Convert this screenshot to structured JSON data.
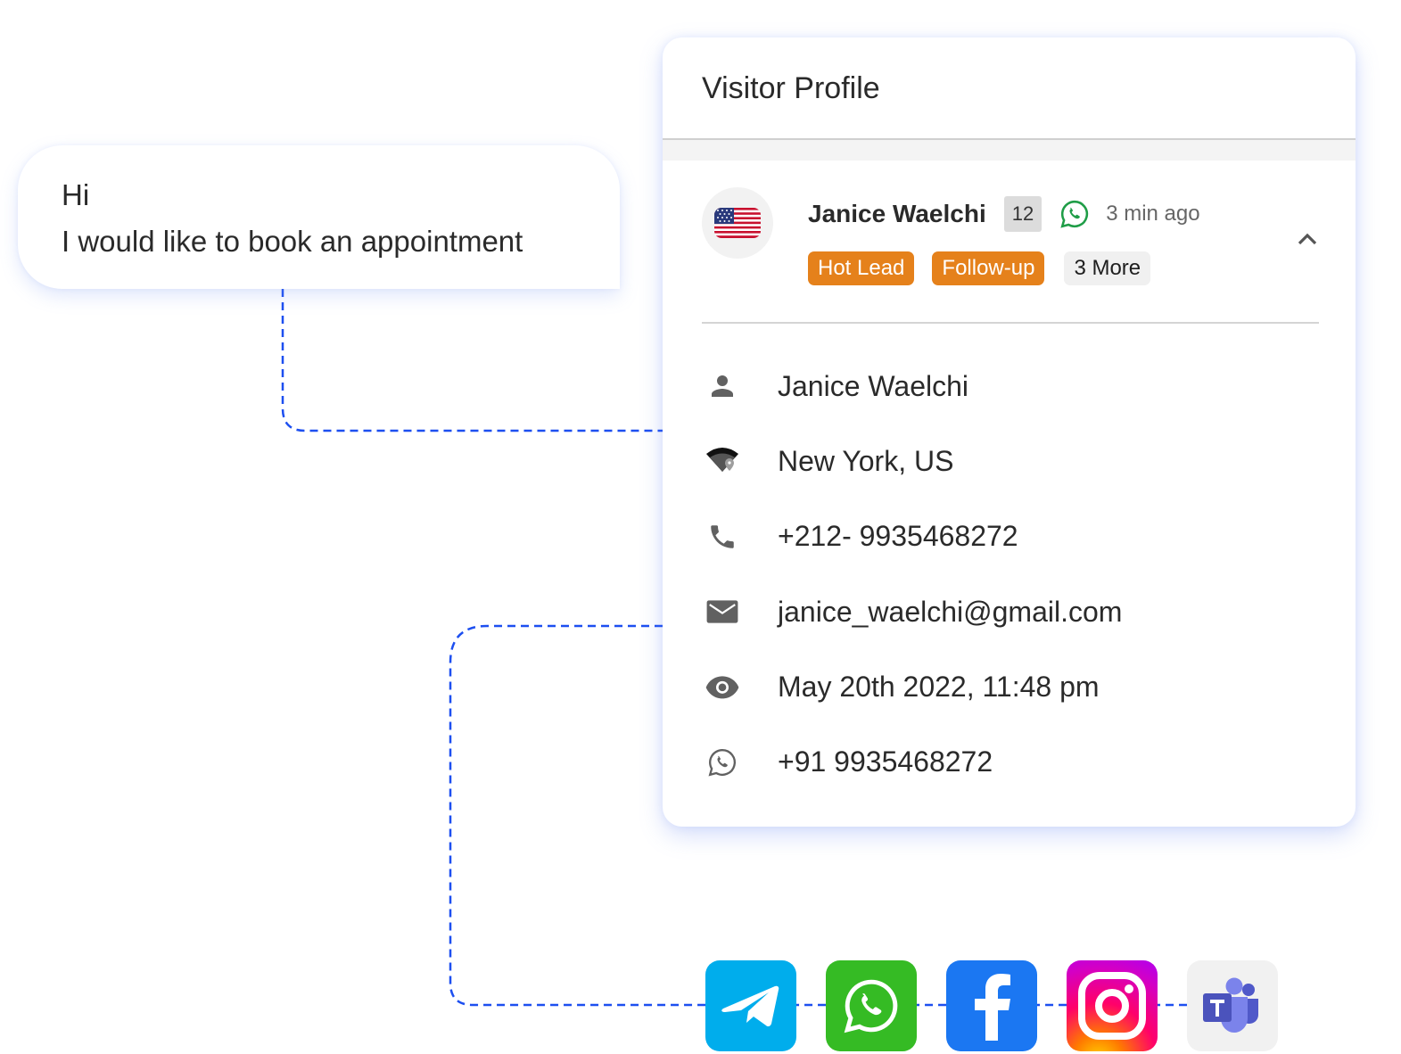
{
  "chat": {
    "lines": [
      "Hi",
      "I would like to book an appointment"
    ]
  },
  "visitor_profile": {
    "title": "Visitor Profile",
    "summary": {
      "flag_icon": "us-flag-icon",
      "name": "Janice Waelchi",
      "count": "12",
      "channel_icon": "whatsapp-icon",
      "time_ago": "3 min ago",
      "tags": [
        "Hot Lead",
        "Follow-up"
      ],
      "more_tags": "3 More",
      "collapse_icon": "chevron-up-icon"
    },
    "details": [
      {
        "icon": "person-icon",
        "value": "Janice Waelchi"
      },
      {
        "icon": "location-icon",
        "value": "New York, US"
      },
      {
        "icon": "phone-icon",
        "value": "+212- 9935468272"
      },
      {
        "icon": "email-icon",
        "value": "janice_waelchi@gmail.com"
      },
      {
        "icon": "eye-icon",
        "value": "May 20th 2022, 11:48 pm"
      },
      {
        "icon": "whatsapp-icon",
        "value": "+91 9935468272"
      }
    ]
  },
  "channels": [
    {
      "name": "Telegram",
      "icon": "telegram-icon",
      "color": "#00adec"
    },
    {
      "name": "WhatsApp",
      "icon": "whatsapp-icon",
      "color": "#35bb24"
    },
    {
      "name": "Facebook",
      "icon": "facebook-icon",
      "color": "#1b77f2"
    },
    {
      "name": "Instagram",
      "icon": "instagram-icon",
      "color": "#ff0169"
    },
    {
      "name": "Microsoft Teams",
      "icon": "teams-icon",
      "color": "#5b5fc7"
    }
  ],
  "colors": {
    "connector": "#1d4ff0",
    "tag_orange": "#e5811b",
    "card_shadow": "#6e8cf0"
  }
}
